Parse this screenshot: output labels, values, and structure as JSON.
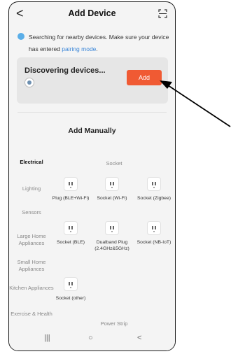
{
  "header": {
    "back": "<",
    "title": "Add Device"
  },
  "search": {
    "text": "Searching for nearby devices. Make sure your device has entered ",
    "link": "pairing mode",
    "suffix": "."
  },
  "discovery": {
    "title": "Discovering devices...",
    "add_label": "Add"
  },
  "manual": {
    "title": "Add Manually"
  },
  "sidebar": {
    "items": [
      {
        "label": "Electrical",
        "active": true
      },
      {
        "label": "Lighting",
        "active": false
      },
      {
        "label": "Sensors",
        "active": false
      },
      {
        "label": "Large Home Appliances",
        "active": false
      },
      {
        "label": "Small Home Appliances",
        "active": false
      },
      {
        "label": "Kitchen Appliances",
        "active": false
      },
      {
        "label": "Exercise & Health",
        "active": false
      }
    ]
  },
  "groups": {
    "socket": "Socket",
    "power_strip": "Power Strip"
  },
  "devices": [
    {
      "label": "Plug (BLE+Wi-Fi)"
    },
    {
      "label": "Socket (Wi-Fi)"
    },
    {
      "label": "Socket (Zigbee)"
    },
    {
      "label": "Socket (BLE)"
    },
    {
      "label": "Dualband Plug (2.4GHz&5GHz)"
    },
    {
      "label": "Socket (NB-IoT)"
    },
    {
      "label": "Socket (other)"
    }
  ],
  "nav": {
    "recents": "|||",
    "home": "○",
    "back": "<"
  },
  "colors": {
    "accent": "#f05a33",
    "link": "#3a86d8"
  }
}
